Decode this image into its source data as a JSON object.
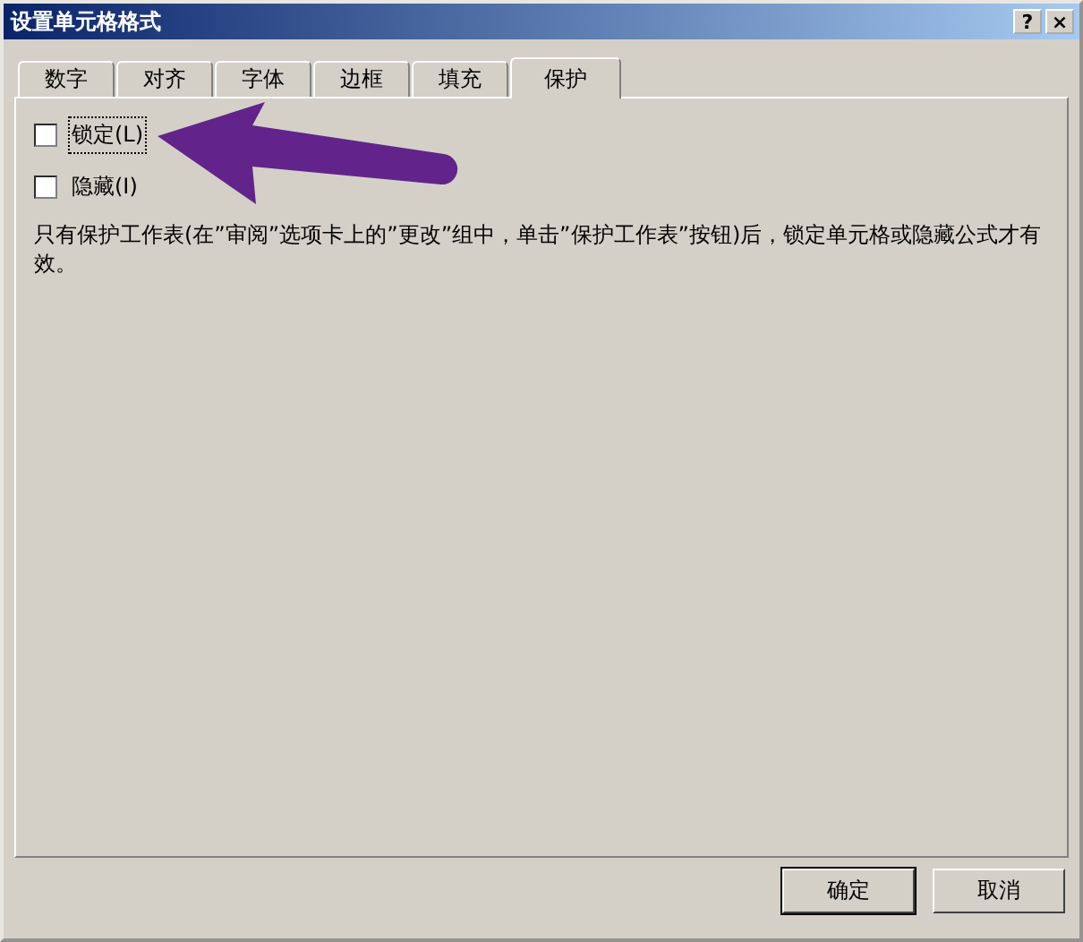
{
  "window": {
    "title": "设置单元格格式",
    "help_button": "?",
    "close_button": "×"
  },
  "tabs": [
    {
      "label": "数字",
      "selected": false
    },
    {
      "label": "对齐",
      "selected": false
    },
    {
      "label": "字体",
      "selected": false
    },
    {
      "label": "边框",
      "selected": false
    },
    {
      "label": "填充",
      "selected": false
    },
    {
      "label": "保护",
      "selected": true
    }
  ],
  "options": [
    {
      "label": "锁定(L)",
      "checked": false,
      "focused": true
    },
    {
      "label": "隐藏(I)",
      "checked": false,
      "focused": false
    }
  ],
  "note": "只有保护工作表(在”审阅”选项卡上的”更改”组中，单击”保护工作表”按钮)后，锁定单元格或隐藏公式才有效。",
  "buttons": [
    {
      "label": "确定",
      "default": true
    },
    {
      "label": "取消",
      "default": false
    }
  ]
}
